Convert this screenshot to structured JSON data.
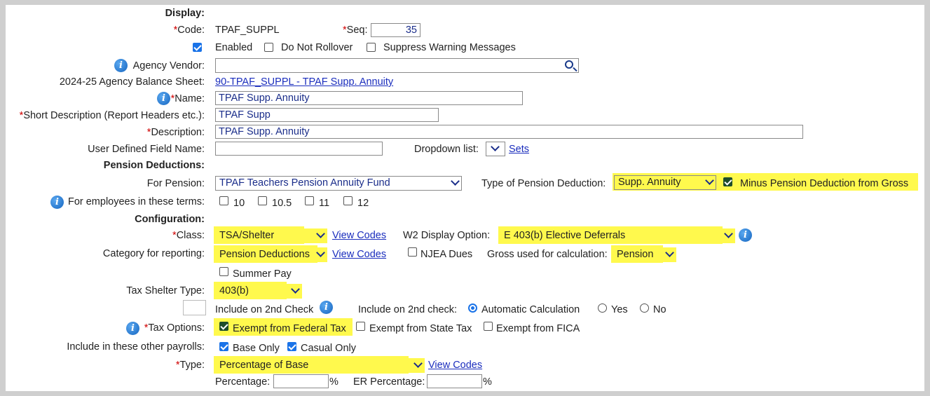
{
  "display": {
    "heading": "Display:"
  },
  "code": {
    "label": "Code:",
    "value": "TPAF_SUPPL"
  },
  "seq": {
    "label": "Seq:",
    "value": "35"
  },
  "flags": {
    "enabled": "Enabled",
    "do_not_rollover": "Do Not Rollover",
    "suppress_warnings": "Suppress Warning Messages"
  },
  "agency_vendor": {
    "label": "Agency Vendor:",
    "value": ""
  },
  "balance_sheet": {
    "label": "2024-25 Agency Balance Sheet:",
    "link": "90-TPAF_SUPPL - TPAF Supp. Annuity"
  },
  "name": {
    "label": "Name:",
    "value": "TPAF Supp. Annuity"
  },
  "short_desc": {
    "label": "Short Description (Report Headers etc.):",
    "value": "TPAF Supp"
  },
  "description": {
    "label": "Description:",
    "value": "TPAF Supp. Annuity"
  },
  "udf": {
    "label": "User Defined Field Name:",
    "value": "",
    "dropdown_label": "Dropdown list:",
    "sets_link": "Sets"
  },
  "pension": {
    "heading": "Pension Deductions:",
    "for_label": "For Pension:",
    "for_value": "TPAF Teachers Pension Annuity Fund",
    "type_label": "Type of Pension Deduction:",
    "type_value": "Supp. Annuity",
    "minus_label": "Minus Pension Deduction from Gross",
    "terms_label": "For employees in these terms:",
    "terms": [
      "10",
      "10.5",
      "11",
      "12"
    ]
  },
  "config": {
    "heading": "Configuration:"
  },
  "class": {
    "label": "Class:",
    "value": "TSA/Shelter",
    "link": "View Codes",
    "w2_label": "W2 Display Option:",
    "w2_value": "E 403(b) Elective Deferrals"
  },
  "category": {
    "label": "Category for reporting:",
    "value": "Pension Deductions",
    "link": "View Codes",
    "njea": "NJEA Dues",
    "gross_label": "Gross used for calculation:",
    "gross_value": "Pension"
  },
  "summer_pay": "Summer Pay",
  "tax_shelter": {
    "label": "Tax Shelter Type:",
    "value": "403(b)"
  },
  "second_check": {
    "include_label": "Include on 2nd Check",
    "option_label": "Include on 2nd check:",
    "auto": "Automatic Calculation",
    "yes": "Yes",
    "no": "No"
  },
  "tax_options": {
    "label": "Tax Options:",
    "federal": "Exempt from Federal Tax",
    "state": "Exempt from State Tax",
    "fica": "Exempt from FICA"
  },
  "other_payrolls": {
    "label": "Include in these other payrolls:",
    "base": "Base Only",
    "casual": "Casual Only"
  },
  "type": {
    "label": "Type:",
    "value": "Percentage of Base",
    "link": "View Codes"
  },
  "percentage": {
    "label": "Percentage:",
    "value": "",
    "unit": "%",
    "er_label": "ER Percentage:",
    "er_value": "",
    "er_unit": "%"
  },
  "colors": {
    "highlight": "#fff94d",
    "link": "#1a2dbd",
    "required": "#d00000",
    "info": "#1565c0"
  }
}
